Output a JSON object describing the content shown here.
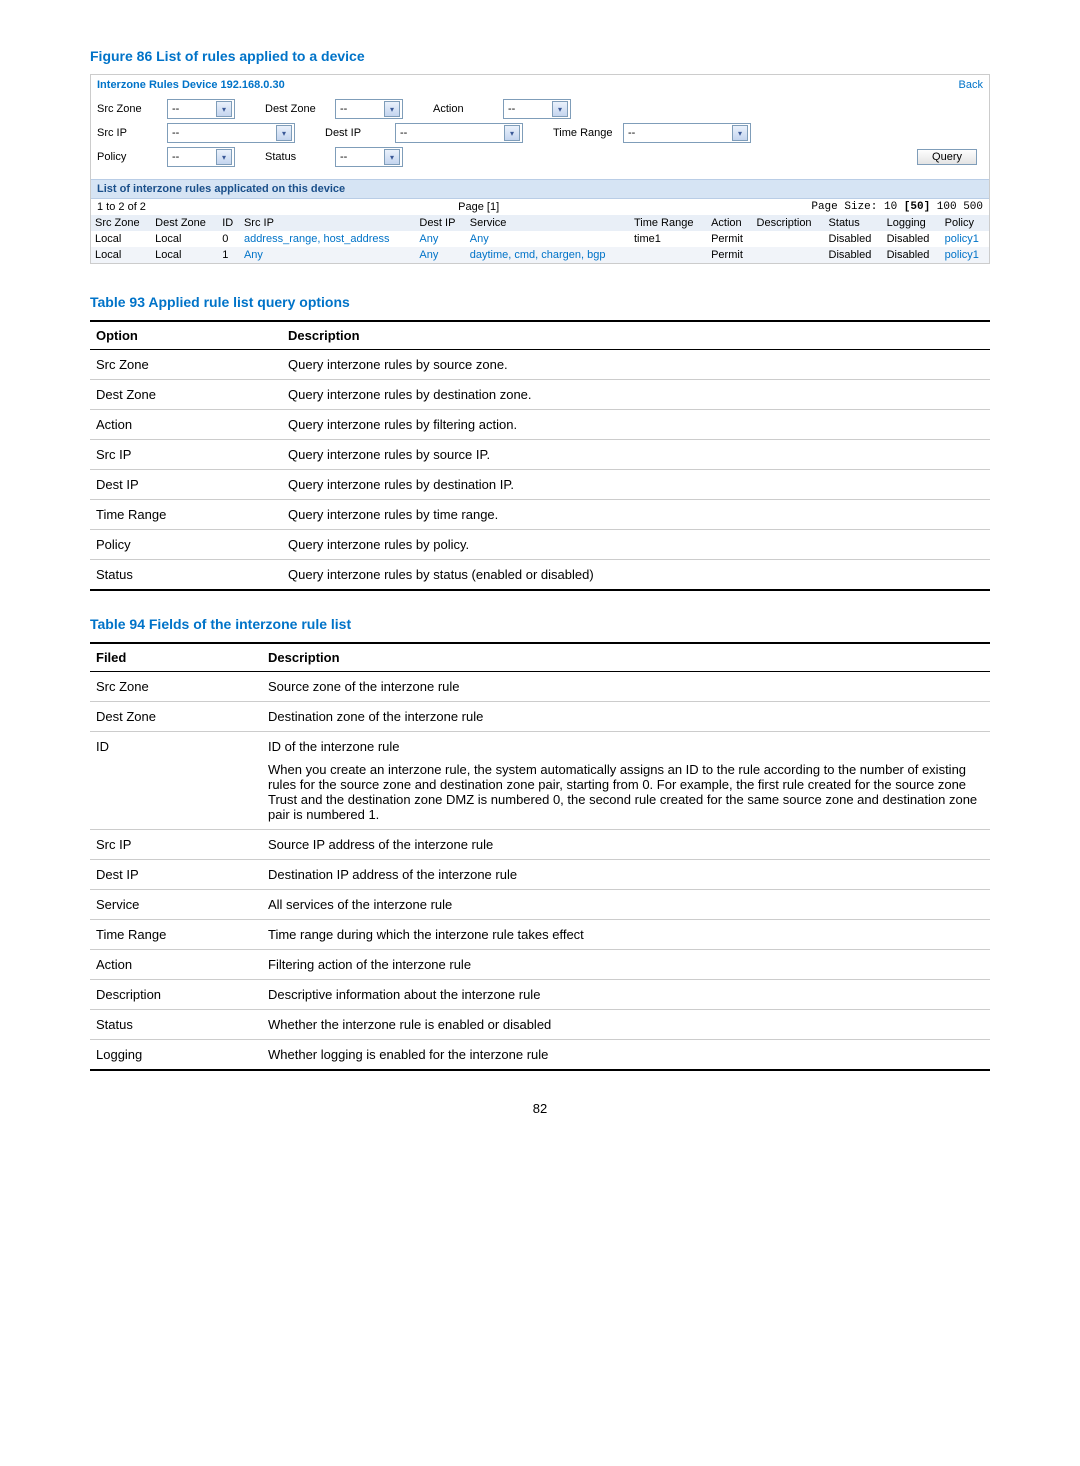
{
  "figure86": {
    "caption": "Figure 86 List of rules applied to a device",
    "title_left": "Interzone Rules   Device 192.168.0.30",
    "back": "Back",
    "filters": {
      "src_zone": "Src Zone",
      "dest_zone": "Dest Zone",
      "action": "Action",
      "src_ip": "Src IP",
      "dest_ip": "Dest IP",
      "time_range": "Time Range",
      "policy": "Policy",
      "status": "Status",
      "dashdash": "--",
      "query_btn": "Query"
    },
    "band": "List of interzone rules applicated on this device",
    "pager": {
      "left": "1 to 2 of 2",
      "center": "Page [1]",
      "right_prefix": "Page Size: 10 ",
      "right_bold": "[50]",
      "right_suffix": " 100 500"
    },
    "columns": [
      "Src Zone",
      "Dest Zone",
      "ID",
      "Src IP",
      "Dest IP",
      "Service",
      "Time Range",
      "Action",
      "Description",
      "Status",
      "Logging",
      "Policy"
    ],
    "rows": [
      {
        "src_zone": "Local",
        "dest_zone": "Local",
        "id": "0",
        "src_ip": "address_range, host_address",
        "dest_ip": "Any",
        "service": "Any",
        "time_range": "time1",
        "action": "Permit",
        "description": "",
        "status": "Disabled",
        "logging": "Disabled",
        "policy": "policy1"
      },
      {
        "src_zone": "Local",
        "dest_zone": "Local",
        "id": "1",
        "src_ip": "Any",
        "dest_ip": "Any",
        "service": "daytime, cmd, chargen, bgp",
        "time_range": "",
        "action": "Permit",
        "description": "",
        "status": "Disabled",
        "logging": "Disabled",
        "policy": "policy1"
      }
    ]
  },
  "table93": {
    "caption": "Table 93 Applied rule list query options",
    "headers": [
      "Option",
      "Description"
    ],
    "rows": [
      [
        "Src Zone",
        "Query interzone rules by source zone."
      ],
      [
        "Dest Zone",
        "Query interzone rules by destination zone."
      ],
      [
        "Action",
        "Query interzone rules by filtering action."
      ],
      [
        "Src IP",
        "Query interzone rules by source IP."
      ],
      [
        "Dest IP",
        "Query interzone rules by destination IP."
      ],
      [
        "Time Range",
        "Query interzone rules by time range."
      ],
      [
        "Policy",
        "Query interzone rules by policy."
      ],
      [
        "Status",
        "Query interzone rules by status (enabled or disabled)"
      ]
    ]
  },
  "table94": {
    "caption": "Table 94 Fields of the interzone rule list",
    "headers": [
      "Filed",
      "Description"
    ],
    "rows": [
      [
        "Src Zone",
        "Source zone of the interzone rule"
      ],
      [
        "Dest Zone",
        "Destination zone of the interzone rule"
      ],
      [
        "ID",
        ""
      ],
      [
        "Src IP",
        "Source IP address of the interzone rule"
      ],
      [
        "Dest IP",
        "Destination IP address of the interzone rule"
      ],
      [
        "Service",
        "All services of the interzone rule"
      ],
      [
        "Time Range",
        "Time range during which the interzone rule takes effect"
      ],
      [
        "Action",
        "Filtering action of the interzone rule"
      ],
      [
        "Description",
        "Descriptive information about the interzone rule"
      ],
      [
        "Status",
        "Whether the interzone rule is enabled or disabled"
      ],
      [
        "Logging",
        "Whether logging is enabled for the interzone rule"
      ]
    ],
    "id_line1": "ID of the interzone rule",
    "id_line2": "When you create an interzone rule, the system automatically assigns an ID to the rule according to the number of existing rules for the source zone and destination zone pair, starting from 0. For example, the first rule created for the source zone Trust and the destination zone DMZ is numbered 0, the second rule created for the same source zone and destination zone pair is numbered 1."
  },
  "page_number": "82"
}
